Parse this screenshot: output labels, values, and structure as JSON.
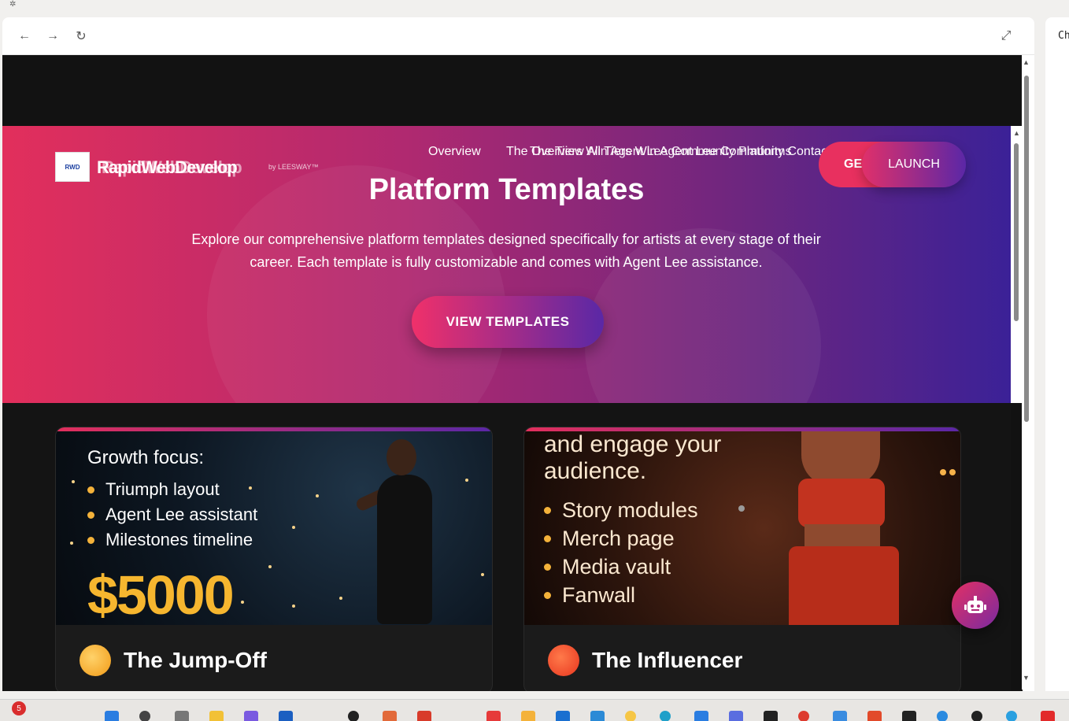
{
  "browser": {
    "back_icon": "←",
    "forward_icon": "→",
    "reload_icon": "↻",
    "expand_icon": "⤢"
  },
  "site": {
    "logo_mark": "RWD",
    "logo_text": "RapidWebDevelop",
    "logo_text_overlay": "RapidWebDevelop",
    "logo_by": "by LEESWAY™",
    "nav": {
      "first": "Overview",
      "jumbled_layer1": "The Overview All Tiers Win Agent Lee Community Contact",
      "jumbled_layer2": "The Tiers Win Agent Lee Community Platforms"
    },
    "btn_get_started": "GE",
    "btn_launch": "LAUNCH"
  },
  "hero": {
    "title": "Platform Templates",
    "description": "Explore our comprehensive platform templates designed specifically for artists at every stage of their career. Each template is fully customizable and comes with Agent Lee assistance.",
    "cta": "VIEW TEMPLATES"
  },
  "cards": [
    {
      "image_heading": "Growth focus:",
      "bullets": [
        "Triumph layout",
        "Agent Lee assistant",
        "Milestones timeline"
      ],
      "price": "$5000",
      "name": "The Jump-Off",
      "badge_color": "#f4a622"
    },
    {
      "image_heading_line1": "and engage your",
      "image_heading_line2": "audience.",
      "bullets": [
        "Story modules",
        "Merch page",
        "Media vault",
        "Fanwall"
      ],
      "name": "The Influencer",
      "badge_color": "#ee4a2a"
    }
  ],
  "bot_icon": "robot-icon",
  "side_panel": {
    "label": "Ch"
  },
  "taskbar": {
    "notification_count": "5"
  },
  "colors": {
    "accent_pink": "#e22f5c",
    "accent_purple": "#3b2197",
    "gold": "#f6b62f"
  }
}
